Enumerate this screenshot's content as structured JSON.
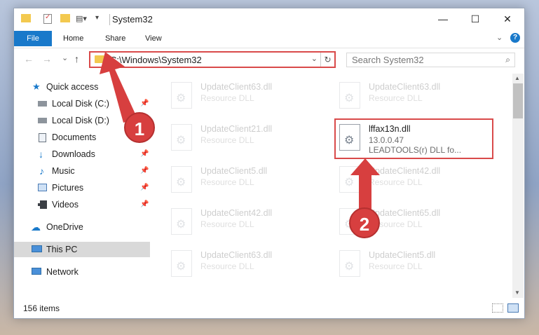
{
  "window": {
    "title": "System32",
    "minimize": "—",
    "maximize": "☐",
    "close": "✕"
  },
  "ribbon": {
    "tabs": [
      "File",
      "Home",
      "Share",
      "View"
    ],
    "collapse": "⌄",
    "help": "?"
  },
  "nav": {
    "back": "←",
    "forward": "→",
    "recent": "⌄",
    "up": "↑",
    "address": "C:\\Windows\\System32",
    "address_dropdown": "⌄",
    "refresh": "↻",
    "search_placeholder": "Search System32",
    "search_icon": "⌕"
  },
  "sidebar": {
    "items": [
      {
        "label": "Quick access",
        "icon": "star-icon"
      },
      {
        "label": "Local Disk (C:)",
        "icon": "drive-icon",
        "pinned": true
      },
      {
        "label": "Local Disk (D:)",
        "icon": "drive-icon"
      },
      {
        "label": "Documents",
        "icon": "documents-icon"
      },
      {
        "label": "Downloads",
        "icon": "download-icon",
        "pinned": true
      },
      {
        "label": "Music",
        "icon": "music-icon",
        "pinned": true
      },
      {
        "label": "Pictures",
        "icon": "pictures-icon",
        "pinned": true
      },
      {
        "label": "Videos",
        "icon": "videos-icon",
        "pinned": true
      },
      {
        "label": "OneDrive",
        "icon": "cloud-icon"
      },
      {
        "label": "This PC",
        "icon": "pc-icon",
        "selected": true
      },
      {
        "label": "Network",
        "icon": "network-icon"
      }
    ],
    "pin_glyph": "📌"
  },
  "files": {
    "left": [
      {
        "name": "UpdateClient63.dll",
        "desc": "Resource DLL"
      },
      {
        "name": "UpdateClient21.dll",
        "desc": "Resource DLL"
      },
      {
        "name": "UpdateClient5.dll",
        "desc": "Resource DLL"
      },
      {
        "name": "UpdateClient42.dll",
        "desc": "Resource DLL"
      },
      {
        "name": "UpdateClient63.dll",
        "desc": "Resource DLL"
      }
    ],
    "right": [
      {
        "name": "UpdateClient63.dll",
        "desc": "Resource DLL"
      },
      {
        "name": "UpdateClient42.dll",
        "desc": "Resource DLL"
      },
      {
        "name": "UpdateClient65.dll",
        "desc": "Resource DLL"
      },
      {
        "name": "UpdateClient5.dll",
        "desc": "Resource DLL"
      }
    ],
    "highlighted": {
      "name": "lffax13n.dll",
      "version": "13.0.0.47",
      "desc": "LEADTOOLS(r) DLL fo..."
    }
  },
  "status": {
    "count": "156 items"
  },
  "callouts": {
    "step1": "1",
    "step2": "2"
  },
  "colors": {
    "accent": "#1979ca",
    "callout": "#d73f3f",
    "folder": "#f3c94f"
  }
}
